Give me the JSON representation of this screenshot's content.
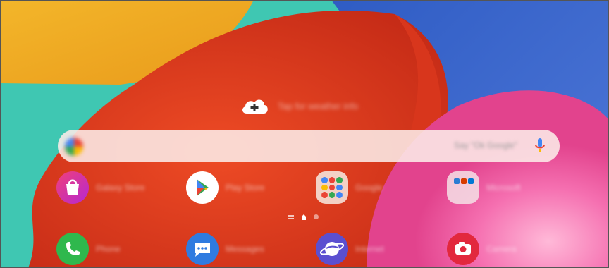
{
  "weather": {
    "prompt": "Tap for weather info",
    "icon": "cloud-plus-icon"
  },
  "search": {
    "placeholder": "Say \"Ok Google\"",
    "google_icon": "google-icon",
    "mic_icon": "mic-icon"
  },
  "apps_row1": [
    {
      "label": "Galaxy Store",
      "icon": "galaxy-store-icon"
    },
    {
      "label": "Play Store",
      "icon": "play-store-icon"
    },
    {
      "label": "Google",
      "icon": "google-folder-icon"
    },
    {
      "label": "Microsoft",
      "icon": "microsoft-folder-icon"
    }
  ],
  "dock": [
    {
      "label": "Phone",
      "icon": "phone-icon"
    },
    {
      "label": "Messages",
      "icon": "messages-icon"
    },
    {
      "label": "Internet",
      "icon": "internet-icon"
    },
    {
      "label": "Camera",
      "icon": "camera-icon"
    }
  ],
  "page_indicator": {
    "pages": 2,
    "current": 1
  },
  "colors": {
    "phone": "#2fb84d",
    "messages": "#2f7be0",
    "internet": "#5b4fd0",
    "camera": "#e2283d",
    "store": "#e1306c"
  }
}
